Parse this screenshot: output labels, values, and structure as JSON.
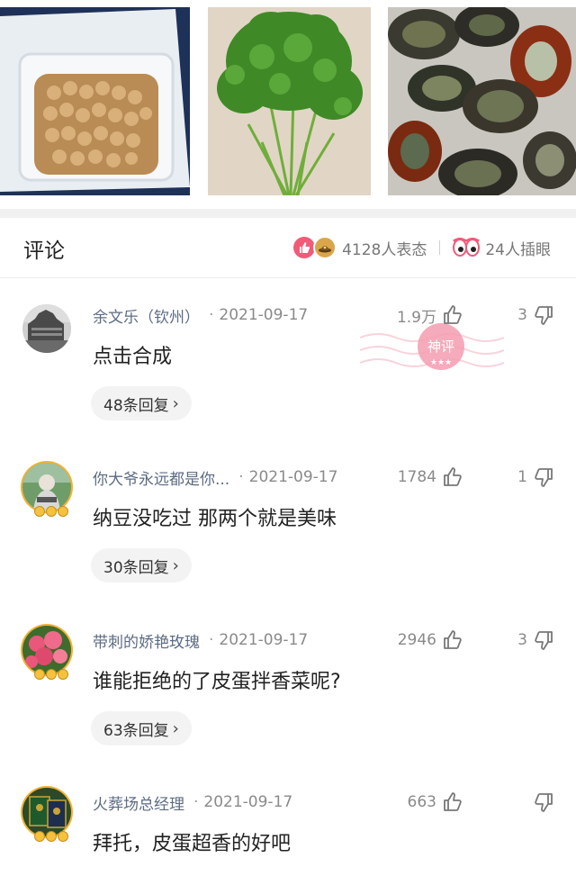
{
  "header": {
    "title": "评论",
    "reactions_label": "4128人表态",
    "watchers_label": "24人插眼"
  },
  "stamp_text": "神评",
  "comments": [
    {
      "user": "余文乐（钦州）",
      "date": "2021-09-17",
      "likes": "1.9万",
      "dislikes": "3",
      "text": "点击合成",
      "replies": "48条回复"
    },
    {
      "user": "你大爷永远都是你...",
      "date": "2021-09-17",
      "likes": "1784",
      "dislikes": "1",
      "text": "纳豆没吃过 那两个就是美味",
      "replies": "30条回复"
    },
    {
      "user": "带刺的娇艳玫瑰",
      "date": "2021-09-17",
      "likes": "2946",
      "dislikes": "3",
      "text": "谁能拒绝的了皮蛋拌香菜呢?",
      "replies": "63条回复"
    },
    {
      "user": "火葬场总经理",
      "date": "2021-09-17",
      "likes": "663",
      "dislikes": "",
      "text": "拜托，皮蛋超香的好吧",
      "replies": ""
    }
  ],
  "icons": {
    "like": "thumbs-up-icon",
    "dislike": "thumbs-down-icon",
    "chevron": "chevron-right-icon"
  },
  "colors": {
    "username": "#5c6b83",
    "accent_pink": "#f25a7a"
  }
}
